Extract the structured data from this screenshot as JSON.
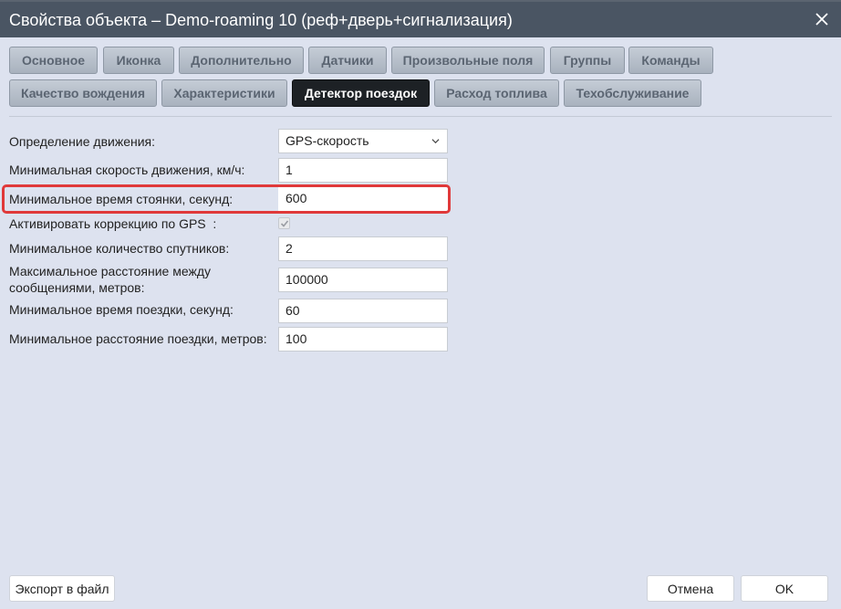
{
  "window": {
    "title": "Свойства объекта – Demo-roaming 10 (реф+дверь+сигнализация)",
    "close_icon": "close-icon"
  },
  "tabs": {
    "row1": [
      "Основное",
      "Иконка",
      "Дополнительно",
      "Датчики",
      "Произвольные поля",
      "Группы",
      "Команды"
    ],
    "row2": [
      "Качество вождения",
      "Характеристики",
      "Детектор поездок",
      "Расход топлива",
      "Техобслуживание"
    ],
    "active": "Детектор поездок"
  },
  "form": {
    "movement_detection": {
      "label": "Определение движения:",
      "value": "GPS-скорость"
    },
    "min_speed": {
      "label": "Минимальная скорость движения, км/ч:",
      "value": "1"
    },
    "min_parking_time": {
      "label": "Минимальное время стоянки, секунд:",
      "value": "600"
    },
    "gps_correction": {
      "label": "Активировать коррекцию по GPS",
      "colon": ":",
      "checked": true
    },
    "min_satellites": {
      "label": "Минимальное количество спутников:",
      "value": "2"
    },
    "max_distance": {
      "label_line1": "Максимальное расстояние между",
      "label_line2": "сообщениями, метров:",
      "value": "100000"
    },
    "min_trip_time": {
      "label": "Минимальное время поездки, секунд:",
      "value": "60"
    },
    "min_trip_distance": {
      "label": "Минимальное расстояние поездки, метров:",
      "value": "100"
    }
  },
  "buttons": {
    "export": "Экспорт в файл",
    "cancel": "Отмена",
    "ok": "OK"
  },
  "colors": {
    "title_bar": "#4a5563",
    "background": "#dde2ef",
    "active_tab": "#1d2125",
    "highlight": "#e0393a"
  }
}
